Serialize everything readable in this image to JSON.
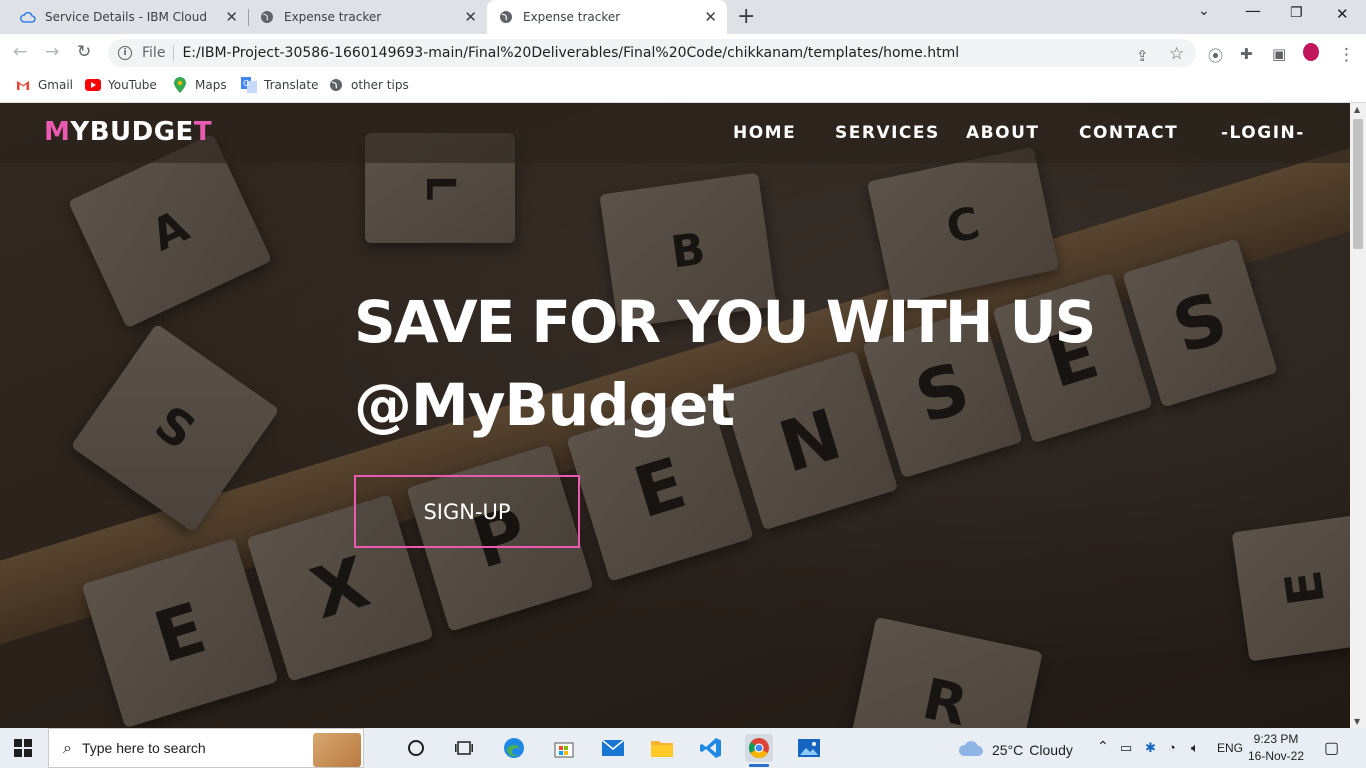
{
  "browser": {
    "tabs": [
      {
        "title": "Service Details - IBM Cloud",
        "active": false
      },
      {
        "title": "Expense tracker",
        "active": false
      },
      {
        "title": "Expense tracker",
        "active": true
      }
    ],
    "address": {
      "scheme": "File",
      "url": "E:/IBM-Project-30586-1660149693-main/Final%20Deliverables/Final%20Code/chikkanam/templates/home.html"
    },
    "bookmarks": [
      {
        "label": "Gmail",
        "icon": "gmail-icon"
      },
      {
        "label": "YouTube",
        "icon": "youtube-icon"
      },
      {
        "label": "Maps",
        "icon": "maps-icon"
      },
      {
        "label": "Translate",
        "icon": "translate-icon"
      },
      {
        "label": "other tips",
        "icon": "globe-icon"
      }
    ]
  },
  "site": {
    "brand": {
      "first": "M",
      "middle": "YBUDGE",
      "last": "T"
    },
    "nav": [
      {
        "label": "HOME"
      },
      {
        "label": "SERVICES"
      },
      {
        "label": "ABOUT"
      },
      {
        "label": "CONTACT"
      },
      {
        "label": "-LOGIN-"
      }
    ],
    "hero": {
      "line1": "SAVE FOR YOU WITH US",
      "line2": "@MyBudget"
    },
    "cta": {
      "label": "SIGN-UP"
    },
    "background_tiles": [
      {
        "letter": "E"
      },
      {
        "letter": "X"
      },
      {
        "letter": "P"
      },
      {
        "letter": "E"
      },
      {
        "letter": "N"
      },
      {
        "letter": "S"
      },
      {
        "letter": "E"
      },
      {
        "letter": "S"
      },
      {
        "letter": "A"
      },
      {
        "letter": "B"
      },
      {
        "letter": "C"
      },
      {
        "letter": "R"
      },
      {
        "letter": "S"
      }
    ]
  },
  "taskbar": {
    "search_placeholder": "Type here to search",
    "weather": {
      "temp": "25°C",
      "condition": "Cloudy"
    },
    "language": "ENG",
    "time": "9:23 PM",
    "date": "16-Nov-22"
  },
  "colors": {
    "accent": "#e85bb0",
    "chrome_bg": "#dee1e6",
    "taskbar_bg": "#e9eef4"
  }
}
